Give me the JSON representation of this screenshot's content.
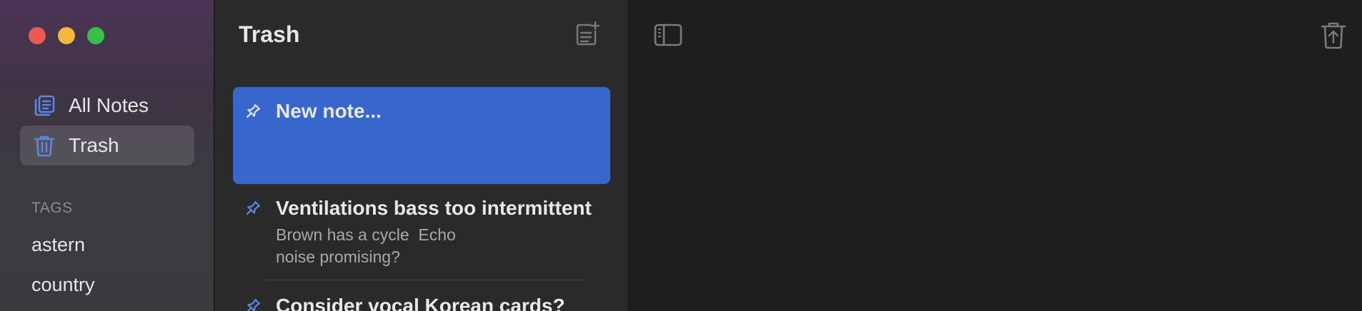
{
  "window": {
    "controls": [
      {
        "name": "close",
        "color": "#ee5a52"
      },
      {
        "name": "minimize",
        "color": "#f4b93b"
      },
      {
        "name": "zoom",
        "color": "#36c045"
      }
    ]
  },
  "sidebar": {
    "items": [
      {
        "label": "All Notes",
        "icon": "all-notes-icon"
      },
      {
        "label": "Trash",
        "icon": "trash-icon",
        "active": true
      }
    ],
    "tags_header": "TAGS",
    "tags": [
      "astern",
      "country"
    ]
  },
  "note_list": {
    "title": "Trash",
    "new_note_icon": "new-note-icon",
    "notes": [
      {
        "title": "New note...",
        "snippet": "",
        "pinned": true,
        "selected": true
      },
      {
        "title": "Ventilations bass too intermittent",
        "snippet": "Brown has a cycle  Echo\nnoise promising?",
        "pinned": true
      },
      {
        "title": "Consider vocal Korean cards?",
        "snippet": "",
        "pinned": true
      }
    ]
  },
  "editor": {
    "toggle_sidebar_icon": "sidebar-toggle-icon",
    "restore_icon": "restore-from-trash-icon"
  },
  "colors": {
    "accent": "#3766cc",
    "icon_blue": "#5b86e5"
  }
}
